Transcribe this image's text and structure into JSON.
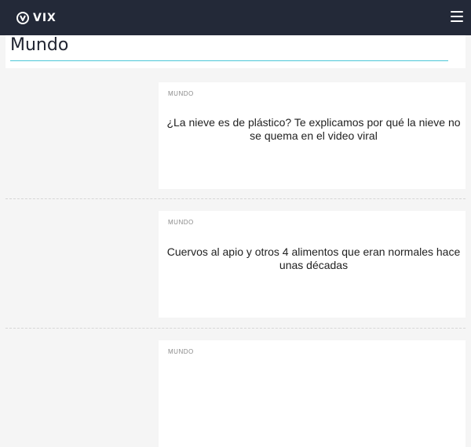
{
  "header": {
    "logo_text": "VIX",
    "logo_icon": "vix-logo-icon",
    "menu_icon": "hamburger-menu-icon",
    "background_color": "#232938"
  },
  "section": {
    "title": "Mundo",
    "accent_color": "#4cc7d8"
  },
  "articles": [
    {
      "category": "MUNDO",
      "title": "¿La nieve es de plástico? Te explicamos por qué la nieve no se quema en el video viral"
    },
    {
      "category": "MUNDO",
      "title": "Cuervos al apio y otros 4 alimentos que eran normales hace unas décadas"
    },
    {
      "category": "MUNDO",
      "title": ""
    }
  ]
}
